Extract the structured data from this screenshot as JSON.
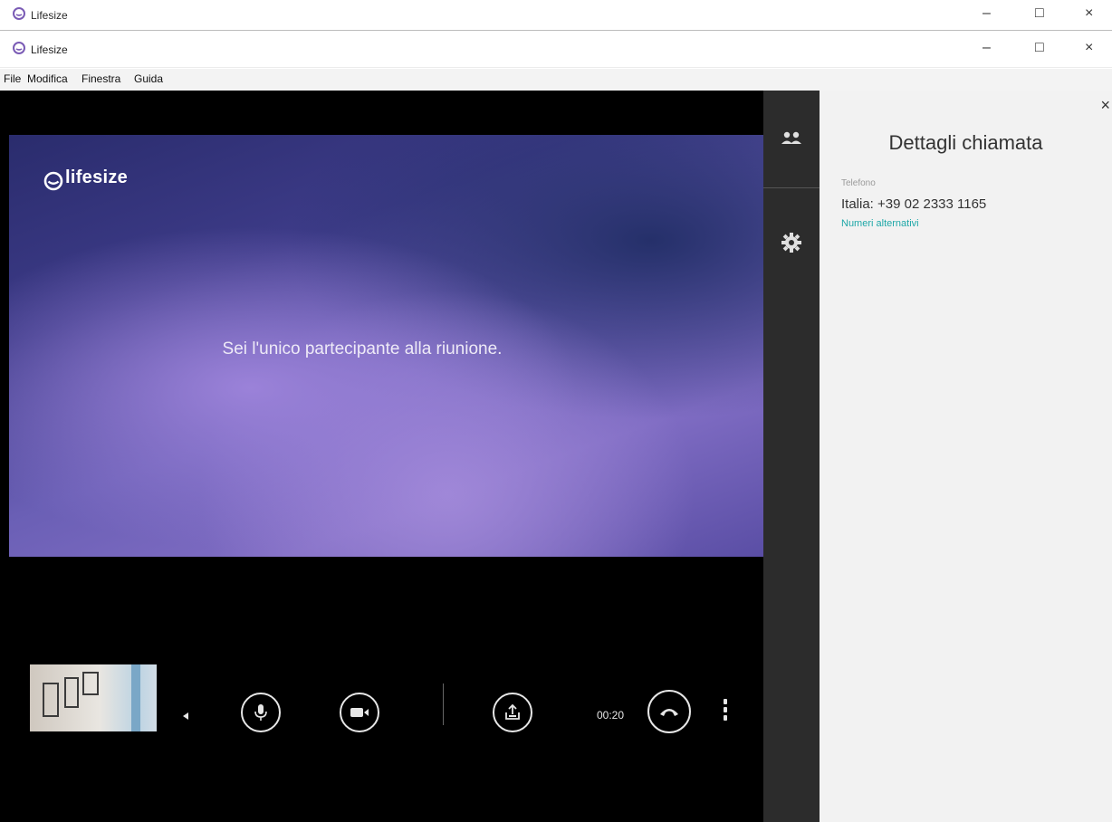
{
  "background_window": {
    "title": "Lifesize",
    "controls": {
      "minimize": "–",
      "maximize": "□",
      "close": "×"
    }
  },
  "window": {
    "title": "Lifesize",
    "controls": {
      "minimize": "–",
      "maximize": "□",
      "close": "×"
    }
  },
  "menu": {
    "items": [
      "File",
      "Modifica",
      "Finestra",
      "Guida"
    ]
  },
  "video": {
    "brand": "lifesize",
    "message": "Sei l'unico partecipante alla riunione.",
    "timer": "00:20"
  },
  "sidebar": {
    "tabs": [
      {
        "icon": "participants-icon"
      },
      {
        "icon": "gear-icon"
      }
    ]
  },
  "details": {
    "close": "×",
    "title": "Dettagli chiamata",
    "phone_label": "Telefono",
    "phone": "Italia: +39 02 2333 1165",
    "alternatives_link": "Numeri alternativi"
  },
  "colors": {
    "accent_link": "#1fa8a8",
    "sidebar_bg": "#2c2c2c",
    "panel_bg": "#f2f2f2"
  }
}
